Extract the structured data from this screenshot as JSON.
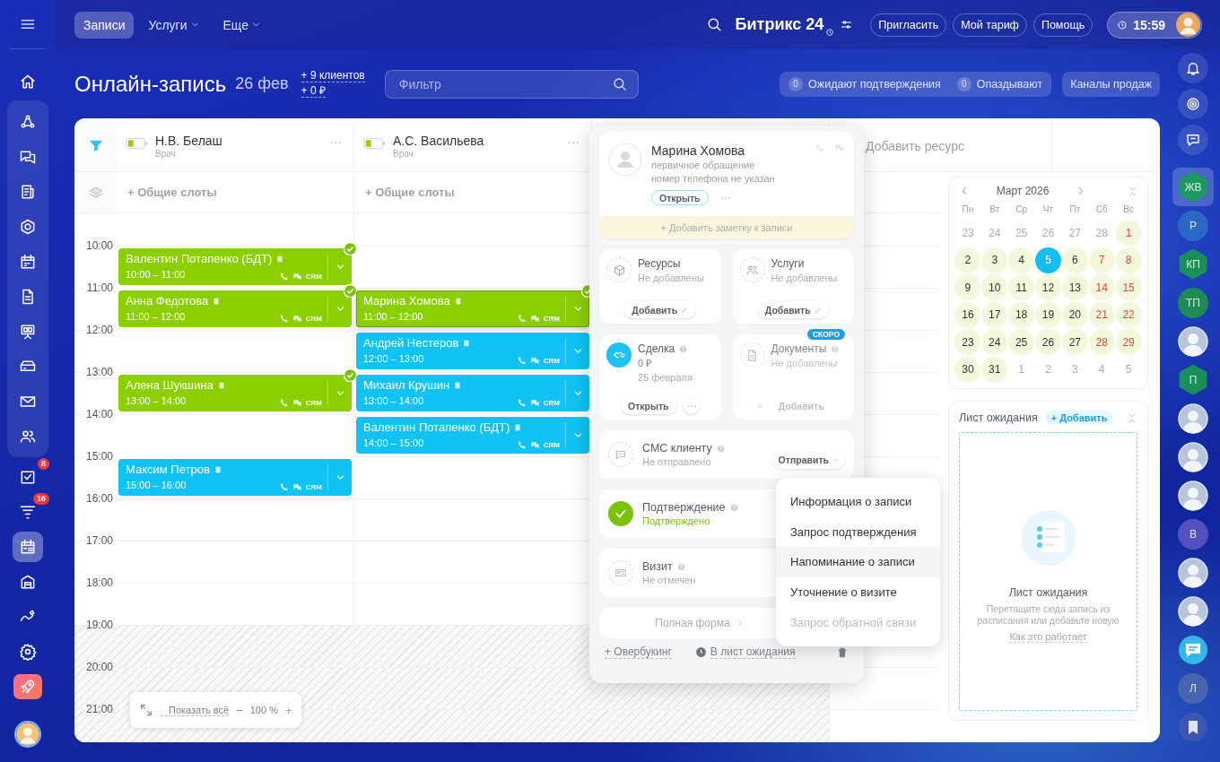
{
  "top_bar": {
    "tabs": [
      {
        "label": "Записи",
        "selected": true,
        "dropdown": false
      },
      {
        "label": "Услуги",
        "selected": false,
        "dropdown": true
      },
      {
        "label": "Еще",
        "selected": false,
        "dropdown": true
      }
    ],
    "brand": "Битрикс 24",
    "buttons": [
      "Пригласить",
      "Мой тариф",
      "Помощь"
    ],
    "time": "15:59"
  },
  "left_sidebar": {
    "items": [
      {
        "selected": false
      },
      {
        "selected": false
      },
      {
        "selected": false
      },
      {
        "selected": false
      },
      {
        "selected": false
      },
      {
        "selected": false
      },
      {
        "selected": false
      },
      {
        "selected": false
      },
      {
        "selected": false
      },
      {
        "selected": false
      },
      {
        "selected": false
      },
      {
        "selected": false,
        "badge": "8"
      },
      {
        "selected": false,
        "badge": "16"
      },
      {
        "selected": true
      },
      {
        "selected": false
      },
      {
        "selected": false
      },
      {
        "selected": false
      },
      {
        "selected": false
      }
    ]
  },
  "header": {
    "title": "Онлайн-запись",
    "date": "26 фев",
    "stats": [
      "+ 9 клиентов",
      "+ 0 ₽"
    ],
    "filter": {
      "placeholder": "Фильтр"
    },
    "counters": [
      {
        "count": "0",
        "label": "Ожидают подтверждения"
      },
      {
        "count": "0",
        "label": "Опаздывают"
      }
    ],
    "channels_button": "Каналы продаж"
  },
  "schedule": {
    "resources": [
      {
        "name": "Н.В. Белаш",
        "role": "Врач",
        "level": 0.35,
        "slots_label": "+ Общие слоты",
        "appointments": [
          {
            "name": "Валентин Потапенко (БДТ)",
            "time": "10:00 – 11:00",
            "crm": "CRM",
            "confirmed": true,
            "selected": false
          },
          {
            "name": "Анна Федотова",
            "time": "11:00 – 12:00",
            "crm": "CRM",
            "confirmed": true,
            "selected": false
          },
          {
            "name": "Алена Шукшина",
            "time": "13:00 – 14:00",
            "crm": "CRM",
            "confirmed": true,
            "selected": false
          },
          {
            "name": "Максим Петров",
            "time": "15:00 – 16:00",
            "crm": "CRM",
            "confirmed": false,
            "selected": false
          }
        ]
      },
      {
        "name": "А.С. Васильева",
        "role": "Врач",
        "level": 0.35,
        "slots_label": "+ Общие слоты",
        "appointments": [
          {
            "name": "Марина Хомова",
            "time": "11:00 – 12:00",
            "crm": "CRM",
            "confirmed": true,
            "selected": true
          },
          {
            "name": "Андрей Нестеров",
            "time": "12:00 – 13:00",
            "crm": "CRM",
            "confirmed": false,
            "selected": false
          },
          {
            "name": "Михаил Крушин",
            "time": "13:00 – 14:00",
            "crm": "CRM",
            "confirmed": false,
            "selected": false
          },
          {
            "name": "Валентин Потапенко (БДТ)",
            "time": "14:00 – 15:00",
            "crm": "CRM",
            "confirmed": false,
            "selected": false
          }
        ]
      }
    ],
    "add_resource": "Добавить ресурс",
    "hours": [
      {
        "label": "10:00",
        "off": false
      },
      {
        "label": "11:00",
        "off": false
      },
      {
        "label": "12:00",
        "off": false
      },
      {
        "label": "13:00",
        "off": false
      },
      {
        "label": "14:00",
        "off": false
      },
      {
        "label": "15:00",
        "off": false
      },
      {
        "label": "16:00",
        "off": false
      },
      {
        "label": "17:00",
        "off": false
      },
      {
        "label": "18:00",
        "off": false
      },
      {
        "label": "19:00",
        "off": true
      },
      {
        "label": "20:00",
        "off": true
      },
      {
        "label": "21:00",
        "off": true
      }
    ],
    "zoom": {
      "show_all": "Показать всё",
      "minus": "−",
      "value": "100 %",
      "plus": "+"
    }
  },
  "popup": {
    "client": {
      "name": "Марина Хомова",
      "lines": [
        "первичное обращение",
        "номер телефона не указан"
      ],
      "open_button": "Открыть"
    },
    "note": "+ Добавить заметку к записи",
    "tiles": [
      {
        "kind": "resource",
        "title": "Ресурсы",
        "status": "Не добавлены",
        "button": "Добавить",
        "disabled": false
      },
      {
        "kind": "service",
        "title": "Услуги",
        "status": "Не добавлены",
        "button": "Добавить",
        "disabled": false
      },
      {
        "kind": "deal",
        "title": "Сделка",
        "amount": "0 ₽",
        "date": "25 февраля",
        "button": "Открыть",
        "disabled": false
      },
      {
        "kind": "document",
        "title": "Документы",
        "status": "Не добавлены",
        "button": "Добавить",
        "badge": "СКОРО",
        "disabled": true
      }
    ],
    "rows": [
      {
        "kind": "sms",
        "title": "СМС клиенту",
        "status": "Не отправлено",
        "action": "Отправить",
        "checked": false
      },
      {
        "kind": "confirmation",
        "title": "Подтверждение",
        "status": "Подтверждено",
        "checked": true
      },
      {
        "kind": "visit",
        "title": "Визит",
        "status": "Не отмечен",
        "checked": false
      }
    ],
    "full_form": "Полная форма",
    "footer": {
      "overbooking": "+ Овербукинг",
      "waitlist": "В лист ожидания"
    }
  },
  "menu": [
    {
      "label": "Информация о записи",
      "selected": false,
      "disabled": false
    },
    {
      "label": "Запрос подтверждения",
      "selected": false,
      "disabled": false
    },
    {
      "label": "Напоминание о записи",
      "selected": true,
      "disabled": false
    },
    {
      "label": "Уточнение о визите",
      "selected": false,
      "disabled": false
    },
    {
      "label": "Запрос обратной связи",
      "selected": false,
      "disabled": true
    }
  ],
  "calendar": {
    "title": "Март 2026",
    "weekdays": [
      "Пн",
      "Вт",
      "Ср",
      "Чт",
      "Пт",
      "Сб",
      "Вс"
    ],
    "weeks": [
      [
        {
          "label": "23",
          "muted": true,
          "weekend": false,
          "available": false,
          "selected": false
        },
        {
          "label": "24",
          "muted": true,
          "weekend": false,
          "available": false,
          "selected": false
        },
        {
          "label": "25",
          "muted": true,
          "weekend": false,
          "available": false,
          "selected": false
        },
        {
          "label": "26",
          "muted": true,
          "weekend": false,
          "available": false,
          "selected": false
        },
        {
          "label": "27",
          "muted": true,
          "weekend": false,
          "available": false,
          "selected": false
        },
        {
          "label": "28",
          "muted": true,
          "weekend": false,
          "available": false,
          "selected": false
        },
        {
          "label": "1",
          "muted": false,
          "weekend": true,
          "available": true,
          "selected": false
        }
      ],
      [
        {
          "label": "2",
          "muted": false,
          "weekend": false,
          "available": true,
          "selected": false
        },
        {
          "label": "3",
          "muted": false,
          "weekend": false,
          "available": true,
          "selected": false
        },
        {
          "label": "4",
          "muted": false,
          "weekend": false,
          "available": true,
          "selected": false
        },
        {
          "label": "5",
          "muted": false,
          "weekend": false,
          "available": true,
          "selected": true
        },
        {
          "label": "6",
          "muted": false,
          "weekend": false,
          "available": true,
          "selected": false
        },
        {
          "label": "7",
          "muted": false,
          "weekend": true,
          "available": true,
          "selected": false
        },
        {
          "label": "8",
          "muted": false,
          "weekend": true,
          "available": true,
          "selected": false
        }
      ],
      [
        {
          "label": "9",
          "muted": false,
          "weekend": false,
          "available": true,
          "selected": false
        },
        {
          "label": "10",
          "muted": false,
          "weekend": false,
          "available": true,
          "selected": false
        },
        {
          "label": "11",
          "muted": false,
          "weekend": false,
          "available": true,
          "selected": false
        },
        {
          "label": "12",
          "muted": false,
          "weekend": false,
          "available": true,
          "selected": false
        },
        {
          "label": "13",
          "muted": false,
          "weekend": false,
          "available": true,
          "selected": false
        },
        {
          "label": "14",
          "muted": false,
          "weekend": true,
          "available": true,
          "selected": false
        },
        {
          "label": "15",
          "muted": false,
          "weekend": true,
          "available": true,
          "selected": false
        }
      ],
      [
        {
          "label": "16",
          "muted": false,
          "weekend": false,
          "available": true,
          "selected": false
        },
        {
          "label": "17",
          "muted": false,
          "weekend": false,
          "available": true,
          "selected": false
        },
        {
          "label": "18",
          "muted": false,
          "weekend": false,
          "available": true,
          "selected": false
        },
        {
          "label": "19",
          "muted": false,
          "weekend": false,
          "available": true,
          "selected": false
        },
        {
          "label": "20",
          "muted": false,
          "weekend": false,
          "available": true,
          "selected": false
        },
        {
          "label": "21",
          "muted": false,
          "weekend": true,
          "available": true,
          "selected": false
        },
        {
          "label": "22",
          "muted": false,
          "weekend": true,
          "available": true,
          "selected": false
        }
      ],
      [
        {
          "label": "23",
          "muted": false,
          "weekend": false,
          "available": true,
          "selected": false
        },
        {
          "label": "24",
          "muted": false,
          "weekend": false,
          "available": true,
          "selected": false
        },
        {
          "label": "25",
          "muted": false,
          "weekend": false,
          "available": true,
          "selected": false
        },
        {
          "label": "26",
          "muted": false,
          "weekend": false,
          "available": true,
          "selected": false
        },
        {
          "label": "27",
          "muted": false,
          "weekend": false,
          "available": true,
          "selected": false
        },
        {
          "label": "28",
          "muted": false,
          "weekend": true,
          "available": true,
          "selected": false
        },
        {
          "label": "29",
          "muted": false,
          "weekend": true,
          "available": true,
          "selected": false
        }
      ],
      [
        {
          "label": "30",
          "muted": false,
          "weekend": false,
          "available": true,
          "selected": false
        },
        {
          "label": "31",
          "muted": false,
          "weekend": false,
          "available": true,
          "selected": false
        },
        {
          "label": "1",
          "muted": true,
          "weekend": false,
          "available": false,
          "selected": false
        },
        {
          "label": "2",
          "muted": true,
          "weekend": false,
          "available": false,
          "selected": false
        },
        {
          "label": "3",
          "muted": true,
          "weekend": false,
          "available": false,
          "selected": false
        },
        {
          "label": "4",
          "muted": true,
          "weekend": false,
          "available": false,
          "selected": false
        },
        {
          "label": "5",
          "muted": true,
          "weekend": false,
          "available": false,
          "selected": false
        }
      ]
    ]
  },
  "waiting_list": {
    "title": "Лист ожидания",
    "add_button": "+ Добавить",
    "empty_title": "Лист ожидания",
    "empty_text": "Перетащите сюда запись из расписания или добавьте новую",
    "help_link": "Как это работает"
  },
  "right_sidebar": {
    "items": [
      {
        "kind": "group",
        "text": "ЖВ",
        "color": "#1d9a62",
        "selected": true
      },
      {
        "kind": "initials",
        "text": "Р",
        "color": "#2c66c6",
        "selected": false
      },
      {
        "kind": "group",
        "text": "КП",
        "color": "#1a8f57",
        "selected": false
      },
      {
        "kind": "initials",
        "text": "ТП",
        "color": "#1e8a55",
        "selected": false
      },
      {
        "kind": "photo",
        "selected": false
      },
      {
        "kind": "group",
        "text": "П",
        "color": "#1a8f57",
        "selected": false
      },
      {
        "kind": "photo",
        "selected": false
      },
      {
        "kind": "photo",
        "selected": false
      },
      {
        "kind": "photo",
        "selected": false
      },
      {
        "kind": "initials",
        "text": "В",
        "color": "#5450c0",
        "selected": false
      },
      {
        "kind": "photo",
        "selected": false
      },
      {
        "kind": "photo",
        "selected": false
      },
      {
        "kind": "chat",
        "selected": false
      },
      {
        "kind": "initials",
        "text": "Л",
        "color": "#4a63b0",
        "selected": false
      },
      {
        "kind": "bookmark",
        "selected": false
      }
    ]
  }
}
